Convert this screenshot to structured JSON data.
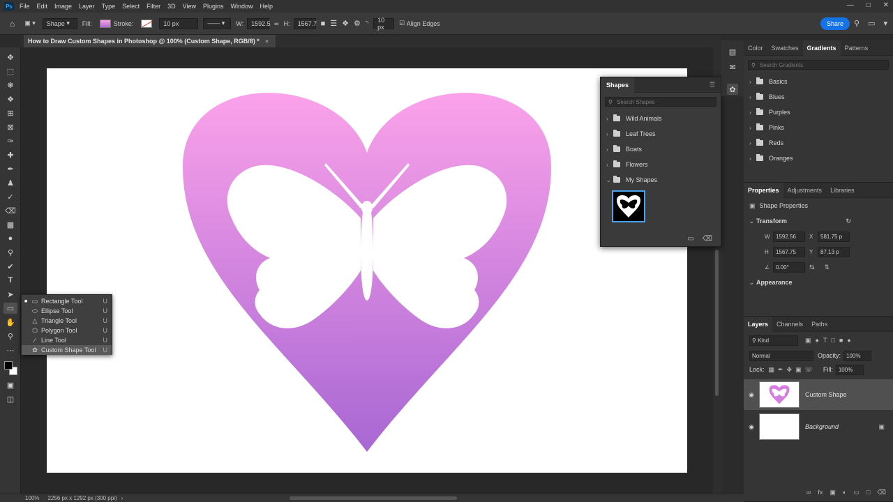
{
  "menubar": {
    "items": [
      "File",
      "Edit",
      "Image",
      "Layer",
      "Type",
      "Select",
      "Filter",
      "3D",
      "View",
      "Plugins",
      "Window",
      "Help"
    ],
    "logo": "Ps"
  },
  "options": {
    "mode": "Shape",
    "fill_label": "Fill:",
    "stroke_label": "Stroke:",
    "stroke_width": "10 px",
    "w_label": "W:",
    "w_value": "1592.5",
    "h_label": "H:",
    "h_value": "1567.7",
    "radius_value": "10 px",
    "align_edges_label": "Align Edges",
    "share_label": "Share"
  },
  "document": {
    "tab_title": "How to Draw Custom Shapes in Photoshop @ 100% (Custom Shape, RGB/8) *",
    "close_glyph": "×"
  },
  "flyout": {
    "items": [
      {
        "label": "Rectangle Tool",
        "key": "U",
        "icon": "rectangle-icon"
      },
      {
        "label": "Ellipse Tool",
        "key": "U",
        "icon": "ellipse-icon"
      },
      {
        "label": "Triangle Tool",
        "key": "U",
        "icon": "triangle-icon"
      },
      {
        "label": "Polygon Tool",
        "key": "U",
        "icon": "polygon-icon"
      },
      {
        "label": "Line Tool",
        "key": "U",
        "icon": "line-icon"
      },
      {
        "label": "Custom Shape Tool",
        "key": "U",
        "icon": "custom-shape-icon"
      }
    ]
  },
  "shapes_panel": {
    "tab": "Shapes",
    "search_placeholder": "Search Shapes",
    "folders": [
      "Wild Animals",
      "Leaf Trees",
      "Boats",
      "Flowers",
      "My Shapes"
    ]
  },
  "gradients_panel": {
    "tabs": [
      "Color",
      "Swatches",
      "Gradients",
      "Patterns"
    ],
    "active_tab": "Gradients",
    "search_placeholder": "Search Gradients",
    "folders": [
      "Basics",
      "Blues",
      "Purples",
      "Pinks",
      "Reds",
      "Oranges"
    ]
  },
  "properties_panel": {
    "tabs": [
      "Properties",
      "Adjustments",
      "Libraries"
    ],
    "subtitle": "Shape Properties",
    "transform_label": "Transform",
    "w_label": "W",
    "w_value": "1592.56",
    "x_label": "X",
    "x_value": "581.75 p",
    "h_label": "H",
    "h_value": "1567.75",
    "y_label": "Y",
    "y_value": "87.13 p",
    "angle_value": "0.00°",
    "appearance_label": "Appearance"
  },
  "layers_panel": {
    "tabs": [
      "Layers",
      "Channels",
      "Paths"
    ],
    "filter_label": "Kind",
    "blend_mode": "Normal",
    "opacity_label": "Opacity:",
    "opacity_value": "100%",
    "lock_label": "Lock:",
    "fill_label": "Fill:",
    "fill_value": "100%",
    "layers": [
      {
        "name": "Custom Shape",
        "selected": true
      },
      {
        "name": "Background",
        "selected": false
      }
    ]
  },
  "statusbar": {
    "zoom": "100%",
    "doc_size": "2256 px x 1292 px (300 ppi)"
  },
  "colors": {
    "heart_top": "#fba2ea",
    "heart_bottom": "#a867d3",
    "accent": "#1473e6"
  }
}
